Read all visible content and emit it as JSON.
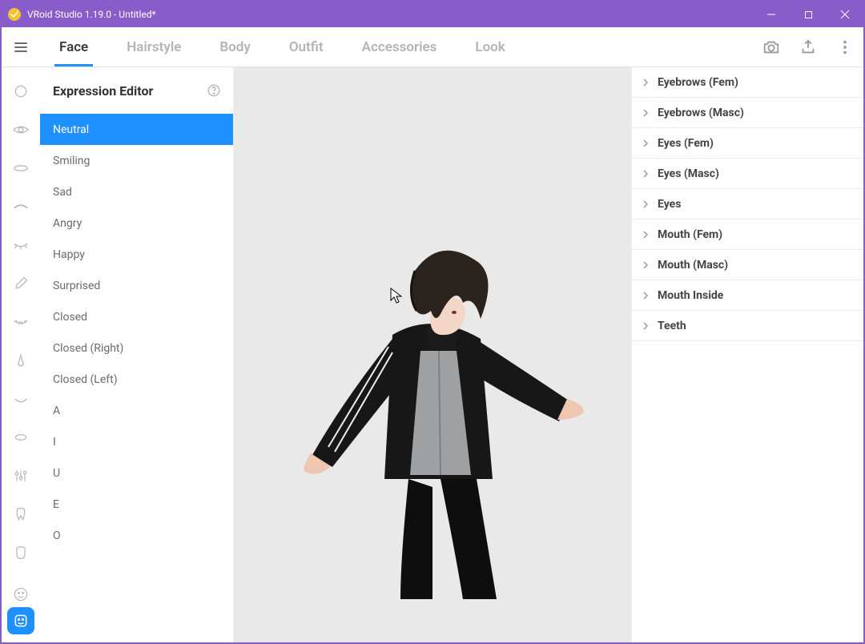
{
  "window": {
    "title": "VRoid Studio 1.19.0 - Untitled*"
  },
  "tabs": {
    "items": [
      {
        "label": "Face",
        "active": true
      },
      {
        "label": "Hairstyle",
        "active": false
      },
      {
        "label": "Body",
        "active": false
      },
      {
        "label": "Outfit",
        "active": false
      },
      {
        "label": "Accessories",
        "active": false
      },
      {
        "label": "Look",
        "active": false
      }
    ]
  },
  "rail": {
    "icons": [
      "face-outline-icon",
      "eye-icon",
      "lips-icon",
      "eyebrow-icon",
      "eyelash-icon",
      "color-picker-icon",
      "wrinkle-icon",
      "nose-icon",
      "mouth-open-icon",
      "ear-icon",
      "sliders-icon",
      "tooth-icon",
      "head-shape-icon",
      "emoji-icon"
    ]
  },
  "panel": {
    "title": "Expression Editor",
    "items": [
      {
        "label": "Neutral",
        "active": true
      },
      {
        "label": "Smiling"
      },
      {
        "label": "Sad"
      },
      {
        "label": "Angry"
      },
      {
        "label": "Happy"
      },
      {
        "label": "Surprised"
      },
      {
        "label": "Closed"
      },
      {
        "label": "Closed (Right)"
      },
      {
        "label": "Closed (Left)"
      },
      {
        "label": "A"
      },
      {
        "label": "I"
      },
      {
        "label": "U"
      },
      {
        "label": "E"
      },
      {
        "label": "O"
      }
    ]
  },
  "accordion": {
    "items": [
      {
        "label": "Eyebrows (Fem)"
      },
      {
        "label": "Eyebrows (Masc)"
      },
      {
        "label": "Eyes (Fem)"
      },
      {
        "label": "Eyes (Masc)"
      },
      {
        "label": "Eyes"
      },
      {
        "label": "Mouth (Fem)"
      },
      {
        "label": "Mouth (Masc)"
      },
      {
        "label": "Mouth Inside"
      },
      {
        "label": "Teeth"
      }
    ]
  },
  "colors": {
    "accent": "#1E90FF",
    "titlebar": "#8a5cc9"
  }
}
